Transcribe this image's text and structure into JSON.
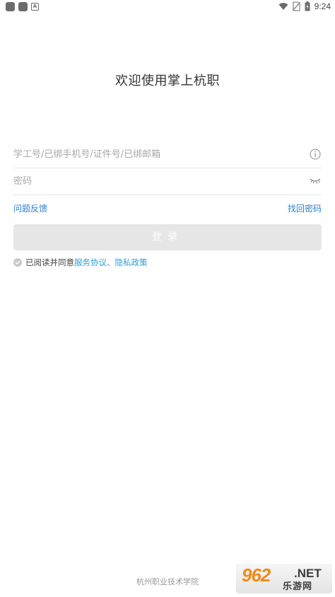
{
  "status_bar": {
    "time": "9:24",
    "icons": [
      "notification-icon",
      "notification-icon",
      "app-a-icon",
      "wifi-icon",
      "no-sim-icon",
      "battery-icon"
    ]
  },
  "title": "欢迎使用掌上杭职",
  "account": {
    "placeholder": "学工号/已绑手机号/证件号/已绑邮箱",
    "value": ""
  },
  "password": {
    "placeholder": "密码",
    "value": ""
  },
  "links": {
    "feedback": "问题反馈",
    "forgot": "找回密码"
  },
  "login_button": "登录",
  "agreement": {
    "prefix": "已阅读并同意",
    "service": "服务协议",
    "separator": "、",
    "privacy": "隐私政策"
  },
  "footer": "杭州职业技术学院",
  "watermark": {
    "number": "962",
    "net": ".NET",
    "text": "乐游网"
  },
  "colors": {
    "link": "#2a7fcf",
    "agree_link": "#2a9fd8",
    "button_bg": "#e6e6e6",
    "watermark_orange": "#f08a1c"
  }
}
